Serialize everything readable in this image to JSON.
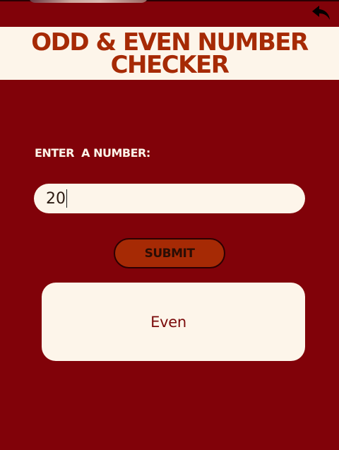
{
  "header": {
    "title": "ODD & EVEN NUMBER CHECKER",
    "back_icon": "reply-arrow-icon"
  },
  "form": {
    "label": "ENTER  A NUMBER:",
    "input_value": "20",
    "submit_label": "SUBMIT"
  },
  "result": {
    "text": "Even"
  },
  "colors": {
    "background": "#810209",
    "panel": "#fdf5ea",
    "accent": "#a62a05",
    "result_text": "#7a0a0a"
  }
}
